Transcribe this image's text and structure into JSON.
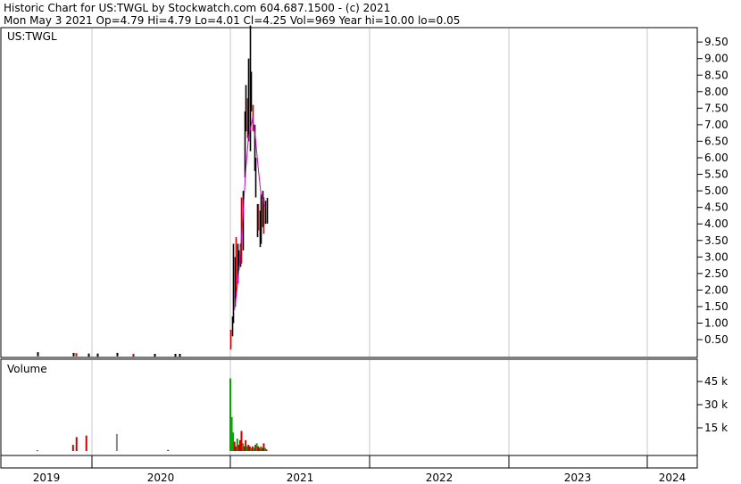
{
  "header": {
    "line1": "Historic Chart for US:TWGL by Stockwatch.com 604.687.1500 - (c) 2021",
    "line2": "Mon May  3 2021   Op=4.79  Hi=4.79  Lo=4.01  Cl=4.25  Vol=969  Year hi=10.00  lo=0.05"
  },
  "chart_data": [
    {
      "type": "candlestick",
      "symbol_label": "US:TWGL",
      "ylim": [
        0,
        10
      ],
      "y_ticks": [
        "0.50",
        "1.00",
        "1.50",
        "2.00",
        "2.50",
        "3.00",
        "3.50",
        "4.00",
        "4.50",
        "5.00",
        "5.50",
        "6.00",
        "6.50",
        "7.00",
        "7.50",
        "8.00",
        "8.50",
        "9.00",
        "9.50"
      ],
      "grid": "on",
      "moving_average_color": "#cc00cc",
      "up_color": "#000000",
      "down_color": "#cc0000",
      "prices": [
        {
          "t": 2019.22,
          "lo": 0.05,
          "hi": 0.12
        },
        {
          "t": 2019.73,
          "lo": 0.05,
          "hi": 0.1
        },
        {
          "t": 2019.77,
          "lo": 0.05,
          "hi": 0.09
        },
        {
          "t": 2019.95,
          "lo": 0.04,
          "hi": 0.08
        },
        {
          "t": 2020.04,
          "lo": 0.04,
          "hi": 0.08
        },
        {
          "t": 2020.18,
          "lo": 0.05,
          "hi": 0.1
        },
        {
          "t": 2020.3,
          "lo": 0.04,
          "hi": 0.07
        },
        {
          "t": 2020.45,
          "lo": 0.04,
          "hi": 0.07
        },
        {
          "t": 2020.6,
          "lo": 0.04,
          "hi": 0.07
        },
        {
          "t": 2020.63,
          "lo": 0.04,
          "hi": 0.07
        },
        {
          "t": 2021.0,
          "lo": 0.2,
          "hi": 0.8
        },
        {
          "t": 2021.01,
          "lo": 0.6,
          "hi": 1.2
        },
        {
          "t": 2021.02,
          "lo": 1.0,
          "hi": 3.4
        },
        {
          "t": 2021.03,
          "lo": 1.5,
          "hi": 3.0
        },
        {
          "t": 2021.04,
          "lo": 1.8,
          "hi": 3.6
        },
        {
          "t": 2021.05,
          "lo": 2.2,
          "hi": 3.4
        },
        {
          "t": 2021.06,
          "lo": 2.6,
          "hi": 3.2
        },
        {
          "t": 2021.07,
          "lo": 2.7,
          "hi": 3.4
        },
        {
          "t": 2021.08,
          "lo": 2.8,
          "hi": 4.8
        },
        {
          "t": 2021.09,
          "lo": 3.2,
          "hi": 5.0
        },
        {
          "t": 2021.1,
          "lo": 5.4,
          "hi": 7.4
        },
        {
          "t": 2021.11,
          "lo": 6.8,
          "hi": 8.2
        },
        {
          "t": 2021.12,
          "lo": 6.6,
          "hi": 7.8
        },
        {
          "t": 2021.13,
          "lo": 6.5,
          "hi": 9.0
        },
        {
          "t": 2021.14,
          "lo": 6.2,
          "hi": 10.0
        },
        {
          "t": 2021.15,
          "lo": 7.4,
          "hi": 8.6
        },
        {
          "t": 2021.16,
          "lo": 6.8,
          "hi": 7.6
        },
        {
          "t": 2021.17,
          "lo": 5.6,
          "hi": 7.0
        },
        {
          "t": 2021.18,
          "lo": 4.8,
          "hi": 6.0
        },
        {
          "t": 2021.19,
          "lo": 3.6,
          "hi": 4.6
        },
        {
          "t": 2021.2,
          "lo": 3.8,
          "hi": 4.6
        },
        {
          "t": 2021.21,
          "lo": 3.3,
          "hi": 4.4
        },
        {
          "t": 2021.22,
          "lo": 3.4,
          "hi": 4.9
        },
        {
          "t": 2021.23,
          "lo": 3.9,
          "hi": 5.0
        },
        {
          "t": 2021.24,
          "lo": 3.7,
          "hi": 4.8
        },
        {
          "t": 2021.25,
          "lo": 4.0,
          "hi": 4.7
        },
        {
          "t": 2021.26,
          "lo": 4.01,
          "hi": 4.79
        }
      ],
      "moving_average": [
        {
          "t": 2021.03,
          "v": 1.4
        },
        {
          "t": 2021.05,
          "v": 2.1
        },
        {
          "t": 2021.07,
          "v": 3.0
        },
        {
          "t": 2021.09,
          "v": 4.2
        },
        {
          "t": 2021.11,
          "v": 5.6
        },
        {
          "t": 2021.13,
          "v": 6.6
        },
        {
          "t": 2021.16,
          "v": 7.2
        },
        {
          "t": 2021.18,
          "v": 6.6
        },
        {
          "t": 2021.2,
          "v": 5.7
        },
        {
          "t": 2021.22,
          "v": 4.9
        },
        {
          "t": 2021.25,
          "v": 4.5
        }
      ]
    },
    {
      "type": "bar",
      "title": "Volume",
      "y_ticks": [
        {
          "value": 15000,
          "label": "15 k"
        },
        {
          "value": 30000,
          "label": "30 k"
        },
        {
          "value": 45000,
          "label": "45 k"
        }
      ],
      "ylim": [
        0,
        52000
      ],
      "volumes": [
        {
          "t": 2019.22,
          "v": 500,
          "c": "#cc0000"
        },
        {
          "t": 2019.73,
          "v": 4000,
          "c": "#cc0000"
        },
        {
          "t": 2019.78,
          "v": 9000,
          "c": "#cc0000"
        },
        {
          "t": 2019.92,
          "v": 10000,
          "c": "#cc0000"
        },
        {
          "t": 2020.18,
          "v": 11000,
          "c": "#888888"
        },
        {
          "t": 2020.55,
          "v": 700,
          "c": "#cc0000"
        },
        {
          "t": 2021.0,
          "v": 47000,
          "c": "#00aa00"
        },
        {
          "t": 2021.01,
          "v": 22000,
          "c": "#00aa00"
        },
        {
          "t": 2021.02,
          "v": 12000,
          "c": "#00aa00"
        },
        {
          "t": 2021.03,
          "v": 6000,
          "c": "#cc0000"
        },
        {
          "t": 2021.04,
          "v": 3000,
          "c": "#cc0000"
        },
        {
          "t": 2021.05,
          "v": 8000,
          "c": "#00aa00"
        },
        {
          "t": 2021.06,
          "v": 4000,
          "c": "#cc0000"
        },
        {
          "t": 2021.07,
          "v": 7000,
          "c": "#cc0000"
        },
        {
          "t": 2021.08,
          "v": 13000,
          "c": "#cc0000"
        },
        {
          "t": 2021.09,
          "v": 5000,
          "c": "#00aa00"
        },
        {
          "t": 2021.1,
          "v": 3000,
          "c": "#cc0000"
        },
        {
          "t": 2021.11,
          "v": 7000,
          "c": "#cc0000"
        },
        {
          "t": 2021.12,
          "v": 3000,
          "c": "#00aa00"
        },
        {
          "t": 2021.13,
          "v": 4000,
          "c": "#cc0000"
        },
        {
          "t": 2021.14,
          "v": 3000,
          "c": "#cc0000"
        },
        {
          "t": 2021.15,
          "v": 2000,
          "c": "#00aa00"
        },
        {
          "t": 2021.16,
          "v": 3000,
          "c": "#cc0000"
        },
        {
          "t": 2021.17,
          "v": 2000,
          "c": "#00aa00"
        },
        {
          "t": 2021.18,
          "v": 4000,
          "c": "#cc0000"
        },
        {
          "t": 2021.19,
          "v": 5000,
          "c": "#00aa00"
        },
        {
          "t": 2021.2,
          "v": 3000,
          "c": "#cc0000"
        },
        {
          "t": 2021.21,
          "v": 2000,
          "c": "#cc0000"
        },
        {
          "t": 2021.22,
          "v": 3000,
          "c": "#00aa00"
        },
        {
          "t": 2021.23,
          "v": 2000,
          "c": "#cc0000"
        },
        {
          "t": 2021.24,
          "v": 5000,
          "c": "#cc0000"
        },
        {
          "t": 2021.25,
          "v": 2000,
          "c": "#00aa00"
        },
        {
          "t": 2021.26,
          "v": 1000,
          "c": "#cc0000"
        }
      ]
    }
  ],
  "x_axis": {
    "years": [
      "2019",
      "2020",
      "2021",
      "2022",
      "2023",
      "2024"
    ],
    "year_starts": [
      2018.7,
      2020.0,
      2021.0,
      2022.0,
      2023.0,
      2024.0,
      2024.35
    ]
  }
}
